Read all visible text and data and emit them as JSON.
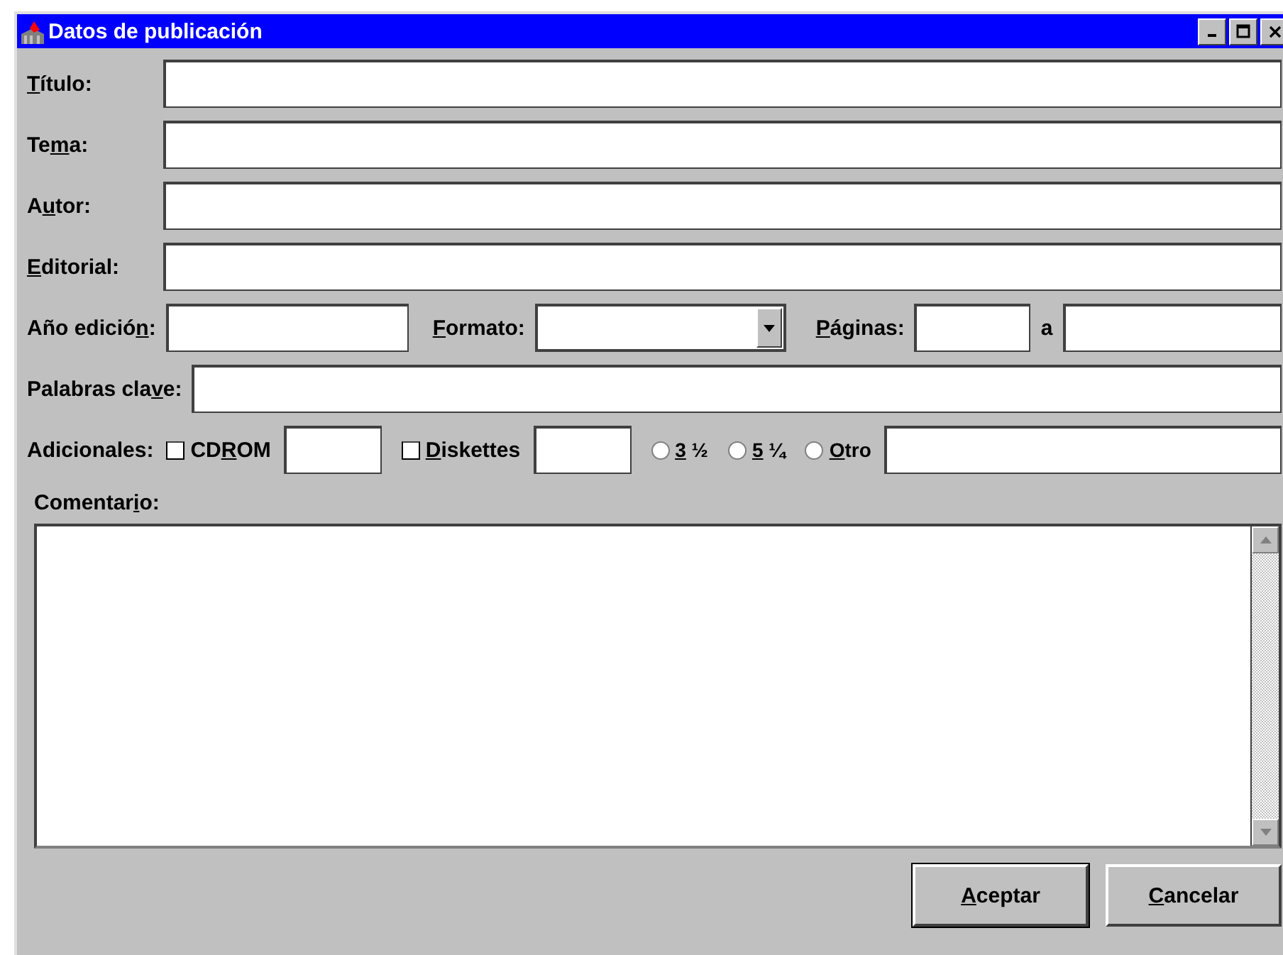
{
  "window": {
    "title": "Datos de publicación"
  },
  "text_fields": [
    {
      "label": {
        "key": "T",
        "post": "ítulo:"
      }
    },
    {
      "label": {
        "pre": "Te",
        "key": "m",
        "post": "a:"
      }
    },
    {
      "label": {
        "pre": "A",
        "key": "u",
        "post": "tor:"
      }
    },
    {
      "label": {
        "key": "E",
        "post": "ditorial:"
      }
    }
  ],
  "edition_row": {
    "year": {
      "label": {
        "pre": "Año edició",
        "key": "n",
        "post": ":"
      }
    },
    "format": {
      "label": {
        "key": "F",
        "post": "ormato:"
      }
    },
    "pages": {
      "label": {
        "key": "P",
        "post": "áginas:"
      },
      "separator": "a"
    }
  },
  "keywords": {
    "label": {
      "pre": "Palabras cla",
      "key": "v",
      "post": "e:"
    }
  },
  "extras": {
    "label": "Adicionales:",
    "options": [
      {
        "kind": "checkbox",
        "label": {
          "pre": "CD",
          "key": "R",
          "post": "OM"
        },
        "checked": false
      },
      {
        "kind": "field"
      },
      {
        "kind": "checkbox",
        "label": {
          "key": "D",
          "post": "iskettes"
        },
        "checked": false
      },
      {
        "kind": "field"
      },
      {
        "kind": "radio",
        "label": {
          "key": "3",
          "post": " ½"
        },
        "selected": false
      },
      {
        "kind": "radio",
        "label": {
          "key": "5",
          "post": " ¼"
        },
        "selected": false
      },
      {
        "kind": "radio",
        "label": {
          "key": "O",
          "post": "tro"
        },
        "selected": false
      },
      {
        "kind": "field"
      }
    ]
  },
  "comment": {
    "label": {
      "pre": "Comentar",
      "key": "i",
      "post": "o:"
    }
  },
  "buttons": [
    {
      "label": {
        "key": "A",
        "post": "ceptar"
      },
      "default": true
    },
    {
      "label": {
        "key": "C",
        "post": "ancelar"
      },
      "default": false
    }
  ]
}
